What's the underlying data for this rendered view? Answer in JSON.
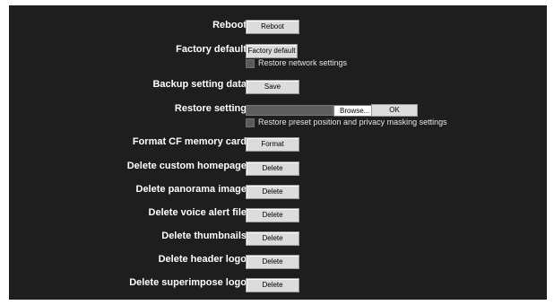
{
  "rows": {
    "reboot": {
      "label": "Reboot",
      "button": "Reboot"
    },
    "factory_default": {
      "label": "Factory default",
      "button": "Factory default",
      "checkbox_label": "Restore network settings"
    },
    "backup": {
      "label": "Backup setting data",
      "button": "Save"
    },
    "restore": {
      "label": "Restore setting",
      "browse_button": "Browse...",
      "ok_button": "OK",
      "checkbox_label": "Restore preset position and privacy masking settings"
    },
    "format_cf": {
      "label": "Format CF memory card",
      "button": "Format"
    },
    "delete_homepage": {
      "label": "Delete custom homepage",
      "button": "Delete"
    },
    "delete_panorama": {
      "label": "Delete panorama image",
      "button": "Delete"
    },
    "delete_voice": {
      "label": "Delete voice alert file",
      "button": "Delete"
    },
    "delete_thumbnails": {
      "label": "Delete thumbnails",
      "button": "Delete"
    },
    "delete_header_logo": {
      "label": "Delete header logo",
      "button": "Delete"
    },
    "delete_superimpose_logo": {
      "label": "Delete superimpose logo",
      "button": "Delete"
    }
  }
}
